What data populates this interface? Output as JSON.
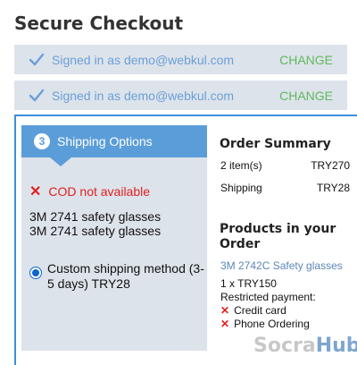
{
  "page": {
    "title": "Secure Checkout"
  },
  "signed_in": [
    {
      "text": "Signed in as demo@webkul.com",
      "action": "CHANGE"
    },
    {
      "text": "Signed in as demo@webkul.com",
      "action": "CHANGE"
    }
  ],
  "shipping": {
    "step_number": "3",
    "header": "Shipping Options",
    "cod_message": "COD not available",
    "products": [
      "3M 2741 safety glasses",
      "3M 2741 safety glasses"
    ],
    "method_label": "Custom shipping method (3-5 days) TRY28",
    "method_selected": true
  },
  "order_summary": {
    "title": "Order Summary",
    "rows": [
      {
        "label": "2 item(s)",
        "value": "TRY270"
      },
      {
        "label": "Shipping",
        "value": "TRY28"
      }
    ]
  },
  "products_in_order": {
    "title": "Products in your Order",
    "product_name": "3M 2742C Safety glasses",
    "quantity_line": "1 x TRY150",
    "restricted_label": "Restricted payment:",
    "restricted_methods": [
      "Credit card",
      "Phone Ordering"
    ]
  },
  "watermark": {
    "part1": "Socra",
    "part2": "Hub"
  },
  "colors": {
    "accent_blue": "#5b9dd8",
    "change_green": "#5fb85f",
    "error_red": "#e02020",
    "panel_gray": "#dde3ea"
  }
}
